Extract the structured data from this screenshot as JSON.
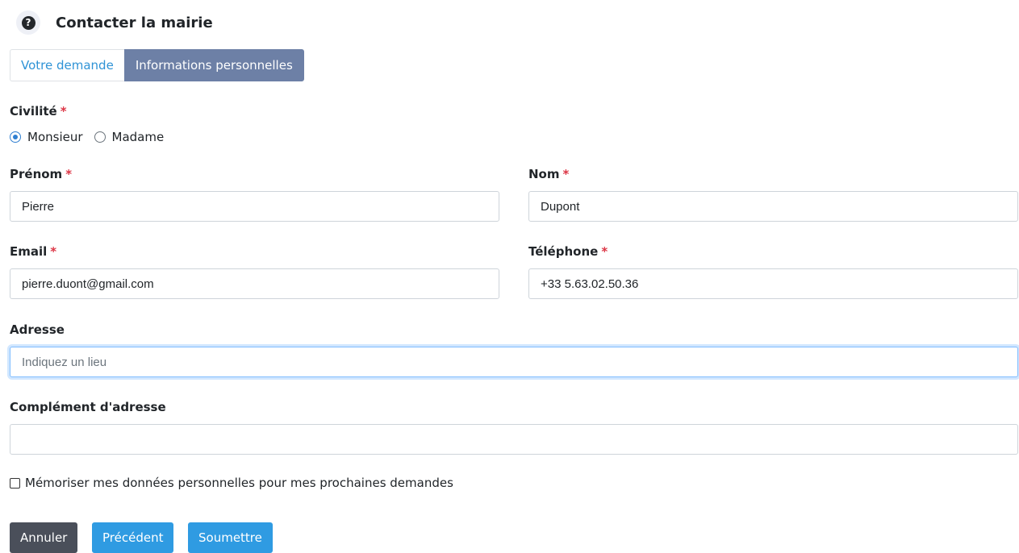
{
  "header": {
    "title": "Contacter la mairie",
    "icon": "help-circle-icon"
  },
  "tabs": [
    {
      "label": "Votre demande",
      "active": false
    },
    {
      "label": "Informations personnelles",
      "active": true
    }
  ],
  "form": {
    "required_mark": "*",
    "civility": {
      "label": "Civilité",
      "options": [
        {
          "label": "Monsieur",
          "checked": true
        },
        {
          "label": "Madame",
          "checked": false
        }
      ]
    },
    "first_name": {
      "label": "Prénom",
      "value": "Pierre"
    },
    "last_name": {
      "label": "Nom",
      "value": "Dupont"
    },
    "email": {
      "label": "Email",
      "value": "pierre.duont@gmail.com"
    },
    "phone": {
      "label": "Téléphone",
      "value": "+33 5.63.02.50.36"
    },
    "address": {
      "label": "Adresse",
      "value": "",
      "placeholder": "Indiquez un lieu"
    },
    "address_complement": {
      "label": "Complément d'adresse",
      "value": ""
    },
    "remember": {
      "label": "Mémoriser mes données personnelles pour mes prochaines demandes",
      "checked": false
    }
  },
  "buttons": {
    "cancel": "Annuler",
    "previous": "Précédent",
    "submit": "Soumettre"
  },
  "colors": {
    "active_tab": "#6d80a6",
    "link": "#2f93d6",
    "primary_button": "#2f9be2",
    "cancel_button": "#4a4f5a",
    "required": "#dc3545"
  }
}
